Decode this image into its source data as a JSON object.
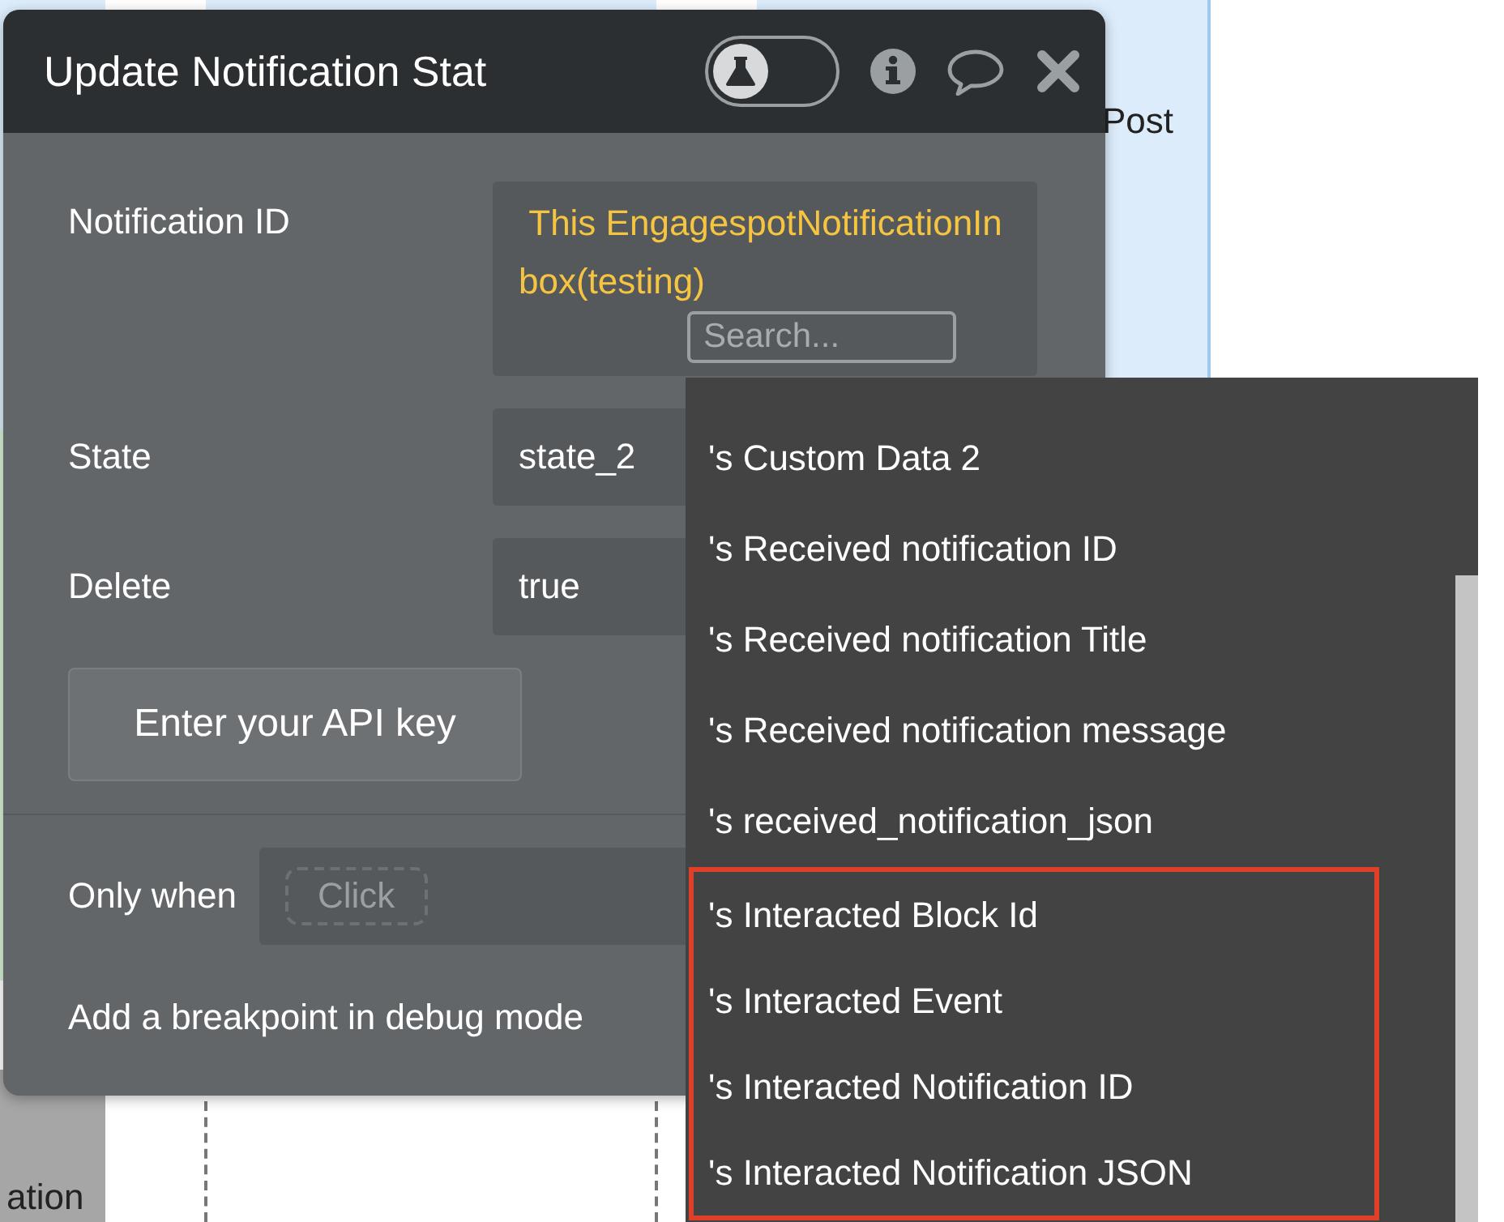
{
  "background": {
    "labels": [
      "Post",
      "ation"
    ]
  },
  "panel": {
    "title": "Update Notification Stat",
    "test_toggle": {
      "on": false
    },
    "fields": [
      {
        "label": "Notification ID",
        "kind": "expression",
        "value": " This EngagespotNotificationInbox(testing)",
        "search_placeholder": "Search..."
      },
      {
        "label": "State",
        "kind": "plain",
        "value": "state_2"
      },
      {
        "label": "Delete",
        "kind": "plain",
        "value": "true"
      }
    ],
    "api_button": "Enter your API key",
    "condition": {
      "label": "Only when",
      "placeholder": "Click"
    },
    "breakpoint_label": "Add a breakpoint in debug mode"
  },
  "dropdown": {
    "items": [
      {
        "label": "'s Custom Data 2",
        "highlighted": false
      },
      {
        "label": "'s Received notification ID",
        "highlighted": false
      },
      {
        "label": "'s Received notification Title",
        "highlighted": false
      },
      {
        "label": "'s Received notification message",
        "highlighted": false
      },
      {
        "label": "'s received_notification_json",
        "highlighted": false
      },
      {
        "label": "'s Interacted Block Id",
        "highlighted": true
      },
      {
        "label": "'s Interacted Event",
        "highlighted": true
      },
      {
        "label": "'s Interacted Notification ID",
        "highlighted": true
      },
      {
        "label": "'s Interacted Notification JSON",
        "highlighted": true
      }
    ]
  }
}
